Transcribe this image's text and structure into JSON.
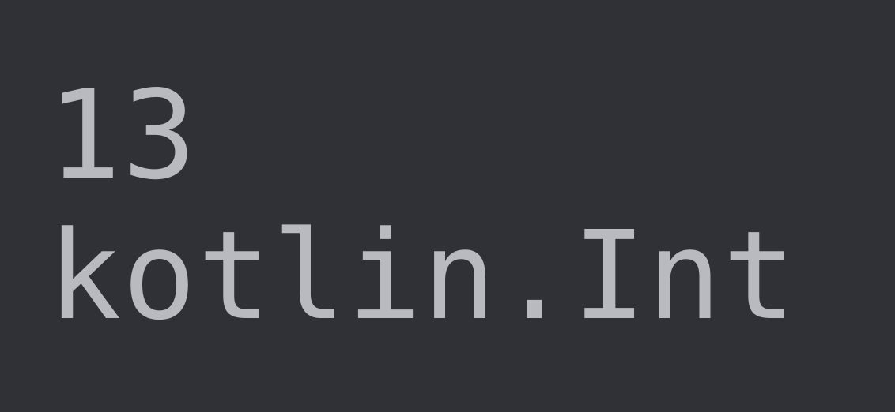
{
  "output": {
    "line1": "13",
    "line2": "kotlin.Int"
  }
}
